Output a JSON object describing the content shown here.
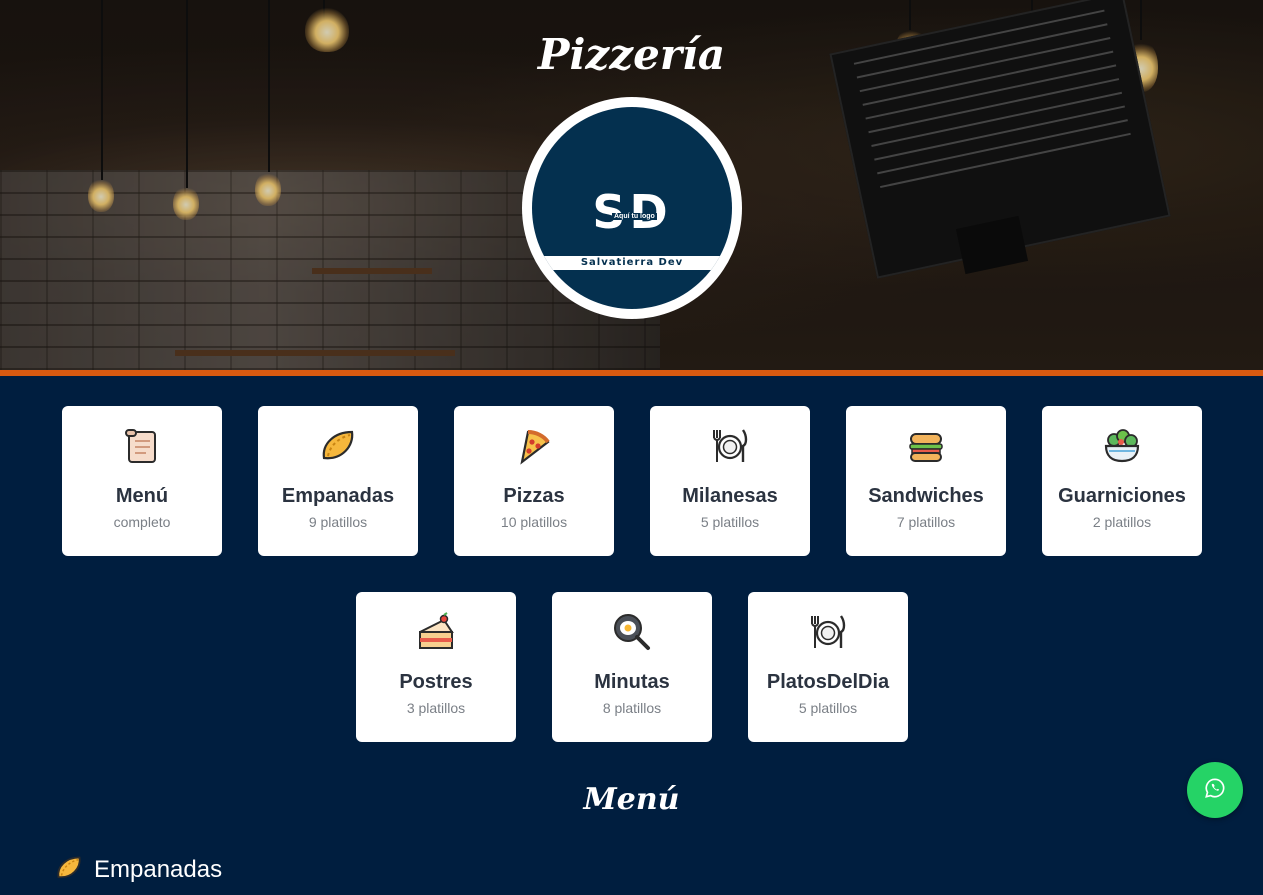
{
  "header": {
    "title": "Pizzería",
    "logo": {
      "initials": "SD",
      "tagline": "Aquí tu logo",
      "name": "Salvatierra Dev",
      "colors": {
        "background": "#04304f",
        "ring": "#ffffff"
      }
    },
    "accent_bar_color": "#d85a10"
  },
  "categories": [
    {
      "icon": "scroll-icon",
      "title": "Menú",
      "subtitle": "completo"
    },
    {
      "icon": "empanada-icon",
      "title": "Empanadas",
      "subtitle": "9 platillos"
    },
    {
      "icon": "pizza-slice-icon",
      "title": "Pizzas",
      "subtitle": "10 platillos"
    },
    {
      "icon": "plate-cutlery-icon",
      "title": "Milanesas",
      "subtitle": "5 platillos"
    },
    {
      "icon": "sandwich-icon",
      "title": "Sandwiches",
      "subtitle": "7 platillos"
    },
    {
      "icon": "salad-bowl-icon",
      "title": "Guarniciones",
      "subtitle": "2 platillos"
    },
    {
      "icon": "cake-slice-icon",
      "title": "Postres",
      "subtitle": "3 platillos"
    },
    {
      "icon": "frying-pan-icon",
      "title": "Minutas",
      "subtitle": "8 platillos"
    },
    {
      "icon": "plate-cutlery-icon",
      "title": "PlatosDelDia",
      "subtitle": "5 platillos"
    }
  ],
  "menu_section": {
    "title": "Menú",
    "first_category": {
      "icon": "empanada-icon",
      "label": "Empanadas"
    }
  },
  "whatsapp_button": {
    "icon": "whatsapp-icon",
    "color": "#25d366"
  },
  "page_background": "#001e3f"
}
